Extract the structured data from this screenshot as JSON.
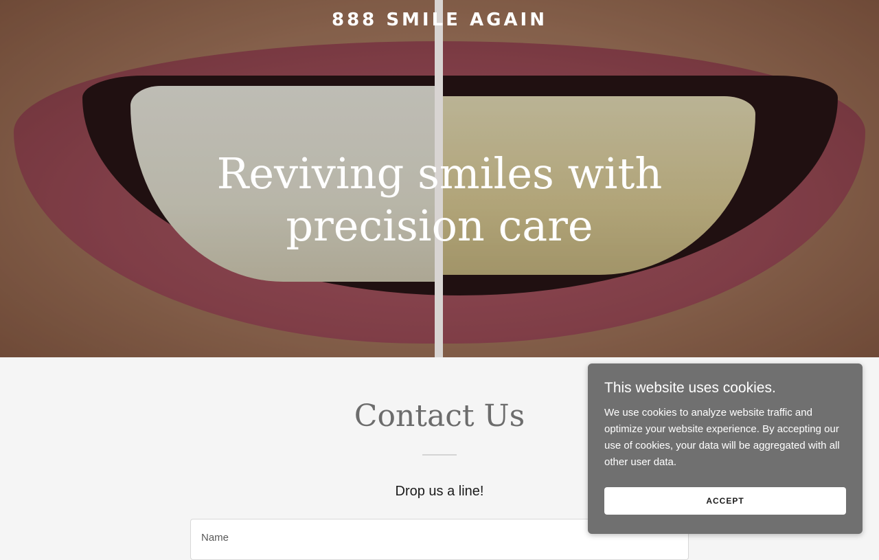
{
  "header": {
    "brand": "888 SMILE AGAIN"
  },
  "hero": {
    "headline": "Reviving smiles with precision care"
  },
  "contact": {
    "title": "Contact Us",
    "subtitle": "Drop us a line!",
    "name_placeholder": "Name"
  },
  "cookie_banner": {
    "title": "This website uses cookies.",
    "body": "We use cookies to analyze website traffic and optimize your website experience. By accepting our use of cookies, your data will be aggregated with all other user data.",
    "accept_label": "ACCEPT"
  },
  "colors": {
    "page_background": "#f5f5f5",
    "cookie_background": "#707070",
    "title_gray": "#6c6c6c"
  }
}
